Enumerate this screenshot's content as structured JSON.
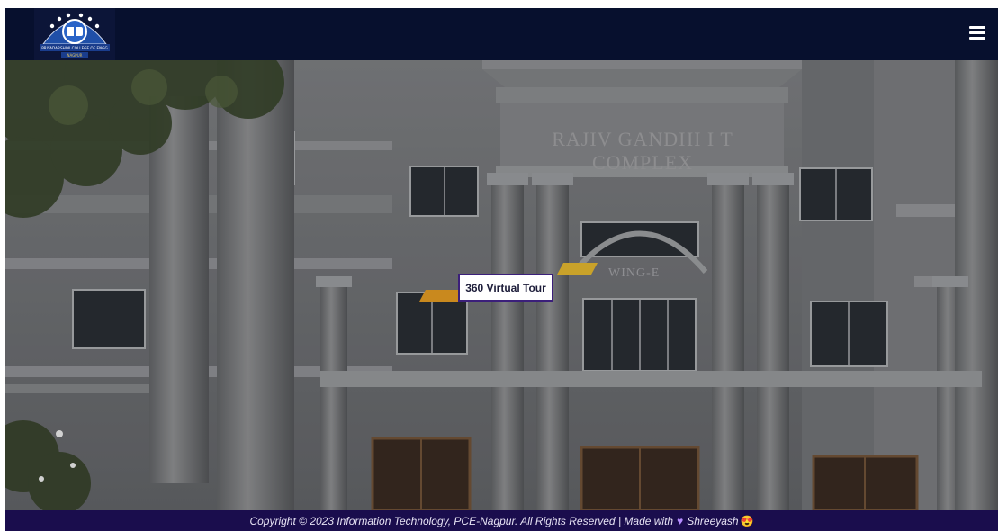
{
  "header": {
    "logo_text": "PRIYADARSHINI COLLEGE OF ENGG",
    "logo_sub": "NAGPUR",
    "menu_icon": "hamburger-menu-icon"
  },
  "hero": {
    "building_sign": "RAJIV GANDHI I T COMPLEX",
    "wing_sign": "WING-E",
    "tour_button_label": "360 Virtual Tour"
  },
  "footer": {
    "text": "Copyright © 2023 Information Technology, PCE-Nagpur. All Rights Reserved | Made with",
    "heart": "♥",
    "author": "Shreeyash",
    "emoji": "😍"
  },
  "colors": {
    "header_bg": "#07102e",
    "footer_bg": "#1a0d4d",
    "tour_border": "#3b1f7a",
    "marker": "#c9891e"
  }
}
